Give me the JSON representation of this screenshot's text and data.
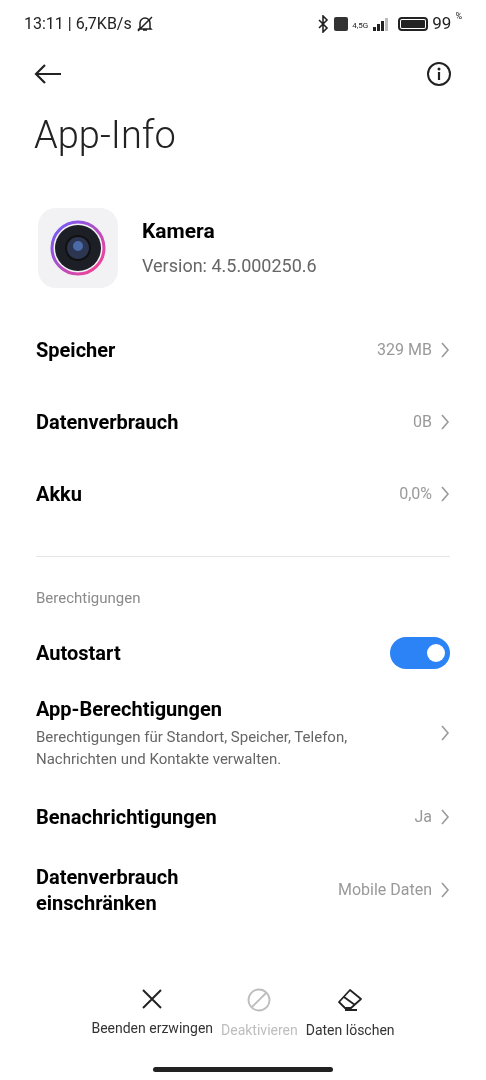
{
  "status_bar": {
    "time": "13:11",
    "speed": "| 6,7KB/s",
    "network": "4,5G",
    "battery": "99",
    "battery_unit": "%"
  },
  "title": "App-Info",
  "app": {
    "name": "Kamera",
    "version": "Version: 4.5.000250.6"
  },
  "details": [
    {
      "label": "Speicher",
      "value": "329 MB"
    },
    {
      "label": "Datenverbrauch",
      "value": "0B"
    },
    {
      "label": "Akku",
      "value": "0,0%"
    }
  ],
  "section": "Berechtigungen",
  "settings": [
    {
      "kind": "toggle",
      "label": "Autostart",
      "on": true
    },
    {
      "kind": "nav",
      "label": "App-Berechtigungen",
      "description": "Berechtigungen für Standort, Speicher, Telefon, Nachrichten und Kontakte verwalten."
    },
    {
      "kind": "nav",
      "label": "Benachrichtigungen",
      "value": "Ja"
    },
    {
      "kind": "nav",
      "label": "Datenverbrauch einschränken",
      "value": "Mobile Daten"
    }
  ],
  "actions": [
    {
      "kind": "close",
      "label": "Beenden erzwingen",
      "disabled": false
    },
    {
      "kind": "block",
      "label": "Deaktivieren",
      "disabled": true
    },
    {
      "kind": "erase",
      "label": "Daten löschen",
      "disabled": false
    }
  ]
}
